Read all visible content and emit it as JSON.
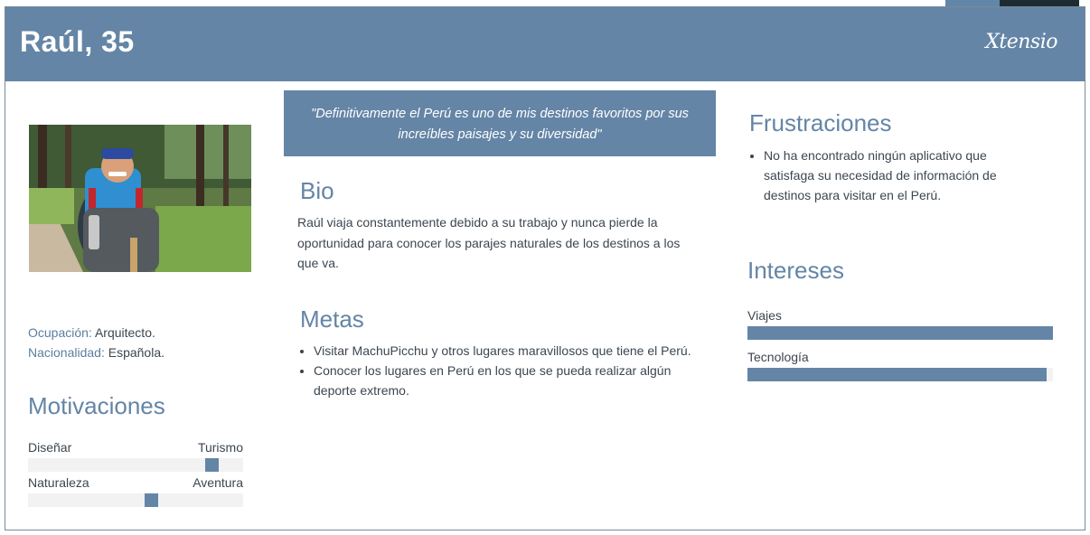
{
  "header": {
    "name": "Raúl, 35",
    "brand": "Xtensio"
  },
  "profile": {
    "occupation_label": "Ocupación:",
    "occupation_value": "Arquitecto.",
    "nationality_label": "Nacionalidad:",
    "nationality_value": "Española."
  },
  "motivations": {
    "title": "Motivaciones",
    "sliders": [
      {
        "left": "Diseñar",
        "right": "Turismo",
        "level": 0.88
      },
      {
        "left": "Naturaleza",
        "right": "Aventura",
        "level": 0.58
      }
    ]
  },
  "quote": "\"Definitivamente el Perú es uno de mis destinos favoritos por sus increíbles paisajes y su diversidad\"",
  "bio": {
    "title": "Bio",
    "text": "Raúl viaja constantemente debido a su trabajo y nunca pierde la oportunidad para conocer los parajes naturales de los destinos a los que va."
  },
  "goals": {
    "title": "Metas",
    "items": [
      "Visitar MachuPicchu y otros lugares maravillosos que tiene el Perú.",
      "Conocer los lugares en Perú en los que se pueda realizar algún deporte extremo."
    ]
  },
  "frustrations": {
    "title": "Frustraciones",
    "items": [
      "No ha encontrado ningún aplicativo que satisfaga su necesidad de información de destinos para visitar en el Perú."
    ]
  },
  "interests": {
    "title": "Intereses",
    "bars": [
      {
        "label": "Viajes",
        "level": 1.0
      },
      {
        "label": "Tecnología",
        "level": 0.98
      }
    ]
  },
  "colors": {
    "accent": "#6485a6",
    "track": "#f2f2f2",
    "text": "#3c4650"
  }
}
